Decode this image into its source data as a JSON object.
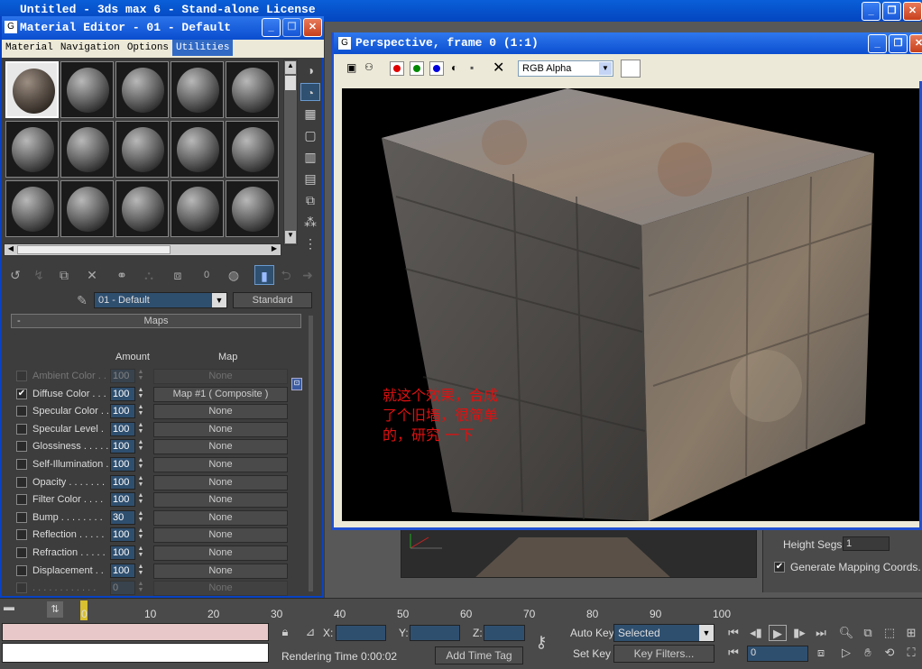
{
  "app": {
    "main_title": "Untitled - 3ds max 6 - Stand-alone License"
  },
  "material_editor": {
    "title": "Material Editor - 01 - Default",
    "menu": [
      "Material",
      "Navigation",
      "Options",
      "Utilities"
    ],
    "active_menu": "Utilities",
    "material_name": "01 - Default",
    "material_type": "Standard",
    "count_readout": "0",
    "maps_rollout_title": "Maps",
    "collapse_symbol": "-",
    "col_amount": "Amount",
    "col_map": "Map",
    "maps": [
      {
        "label": "Ambient Color . . .",
        "checked": false,
        "amount": "100",
        "map": "None",
        "dim": true
      },
      {
        "label": "Diffuse Color . . .",
        "checked": true,
        "amount": "100",
        "map": "Map #1  ( Composite )",
        "dim": false
      },
      {
        "label": "Specular Color . .",
        "checked": false,
        "amount": "100",
        "map": "None",
        "dim": false
      },
      {
        "label": "Specular Level  .",
        "checked": false,
        "amount": "100",
        "map": "None",
        "dim": false
      },
      {
        "label": "Glossiness . . . . .",
        "checked": false,
        "amount": "100",
        "map": "None",
        "dim": false
      },
      {
        "label": "Self-Illumination .",
        "checked": false,
        "amount": "100",
        "map": "None",
        "dim": false
      },
      {
        "label": "Opacity . . . . . . .",
        "checked": false,
        "amount": "100",
        "map": "None",
        "dim": false
      },
      {
        "label": "Filter Color  . . . .",
        "checked": false,
        "amount": "100",
        "map": "None",
        "dim": false
      },
      {
        "label": "Bump  . . . . . . . .",
        "checked": false,
        "amount": "30",
        "map": "None",
        "dim": false
      },
      {
        "label": "Reflection  . . . . .",
        "checked": false,
        "amount": "100",
        "map": "None",
        "dim": false
      },
      {
        "label": "Refraction  . . . . .",
        "checked": false,
        "amount": "100",
        "map": "None",
        "dim": false
      },
      {
        "label": "Displacement  . .",
        "checked": false,
        "amount": "100",
        "map": "None",
        "dim": false
      },
      {
        "label": ". . . . . . . . . . . .",
        "checked": false,
        "amount": "0",
        "map": "None",
        "dim": true
      },
      {
        "label": ". . . . . . . . . . . .",
        "checked": false,
        "amount": "0",
        "map": "None",
        "dim": true
      }
    ]
  },
  "render_window": {
    "title": "Perspective, frame 0 (1:1)",
    "channel": "RGB Alpha",
    "caption_lines": [
      "就这个效果，合成",
      "了个旧墙，很简单",
      "的，研究 一下"
    ],
    "caption_color": "#e01010"
  },
  "command_panel": {
    "height_segs_label": "Height Segs:",
    "height_segs_value": "1",
    "gen_mapping_label": "Generate Mapping Coords.",
    "gen_mapping_checked": true
  },
  "timeline": {
    "ticks": [
      "0",
      "10",
      "20",
      "30",
      "40",
      "50",
      "60",
      "70",
      "80",
      "90",
      "100"
    ]
  },
  "status": {
    "x_label": "X:",
    "y_label": "Y:",
    "z_label": "Z:",
    "auto_key": "Auto Key",
    "set_key": "Set Key",
    "selected": "Selected",
    "key_filters": "Key Filters...",
    "rendering_time": "Rendering Time  0:00:02",
    "add_time_tag": "Add Time Tag",
    "frame": "0"
  },
  "icons": [
    "app-icon",
    "minimize-icon",
    "maximize-icon",
    "close-icon",
    "sphere-icon",
    "lock-icon",
    "key-icon",
    "play-icon",
    "zoom-icon"
  ]
}
